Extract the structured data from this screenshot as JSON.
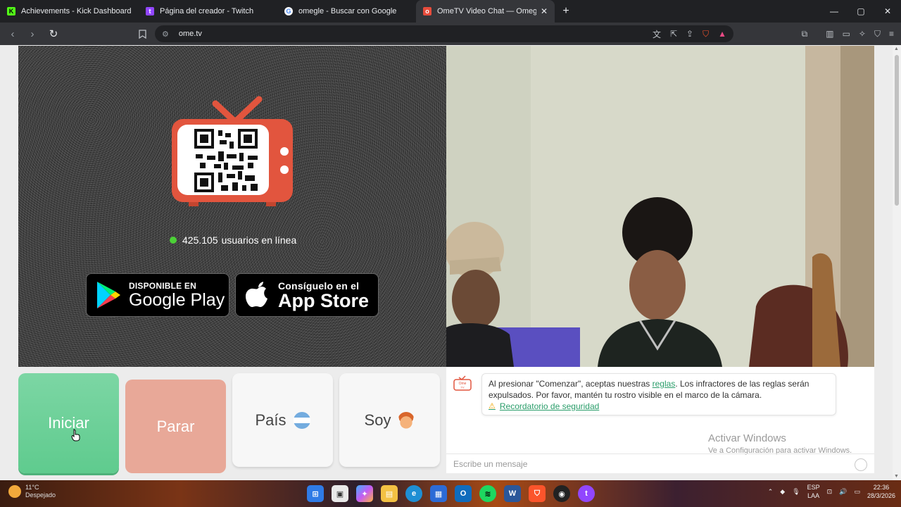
{
  "browser": {
    "tabs": [
      {
        "title": "Achievements - Kick Dashboard",
        "favicon": "K",
        "color": "#53fc18",
        "active": false
      },
      {
        "title": "Página del creador - Twitch",
        "favicon": "t",
        "color": "#9146ff",
        "active": false
      },
      {
        "title": "omegle - Buscar con Google",
        "favicon": "G",
        "color": "#4285f4",
        "active": false
      },
      {
        "title": "OmeTV Video Chat — Omegle",
        "favicon": "o",
        "color": "#e74c3c",
        "active": true
      }
    ],
    "new_tab": "+",
    "url": "ome.tv",
    "window_controls": {
      "minimize": "—",
      "maximize": "▢",
      "close": "✕"
    }
  },
  "left_panel": {
    "online_count": "425.105",
    "online_label": "usuarios en línea",
    "google_play": {
      "small": "DISPONIBLE EN",
      "big": "Google Play"
    },
    "app_store": {
      "small": "Consíguelo en el",
      "big": "App Store"
    }
  },
  "controls": {
    "start": "Iniciar",
    "stop": "Parar",
    "country": "País",
    "gender": "Soy"
  },
  "chat": {
    "logo_text": "Ome TV",
    "message_pre": "Al presionar \"Comenzar\", aceptas nuestras ",
    "message_link": "reglas",
    "message_post": ". Los infractores de las reglas serán expulsados. Por favor, mantén tu rostro visible en el marco de la cámara.",
    "security_link": "Recordatorio de seguridad",
    "input_placeholder": "Escribe un mensaje",
    "activate_title": "Activar Windows",
    "activate_sub": "Ve a Configuración para activar Windows."
  },
  "taskbar": {
    "weather_temp": "11°C",
    "weather_desc": "Despejado",
    "lang": "ESP",
    "lang2": "LAA",
    "time": "22:36",
    "date": "28/3/2026"
  },
  "colors": {
    "start_green": "#5fcb8e",
    "stop_salmon": "#e8a898",
    "link_green": "#2a9d6a",
    "tv_red": "#e2553e",
    "online_dot": "#4cd137"
  }
}
